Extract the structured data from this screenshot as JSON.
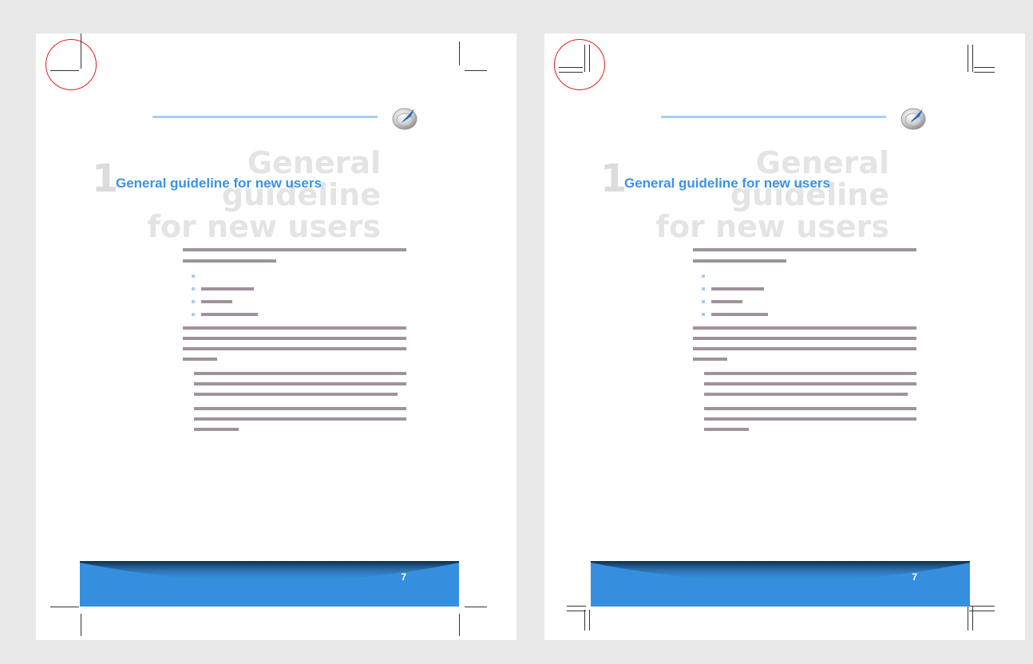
{
  "spread": {
    "left_page": {
      "chapter_number": "1",
      "chapter_title_ghost_line1": "General guideline",
      "chapter_title_ghost_line2": "for new users",
      "chapter_title": "General guideline for new users",
      "page_number": "7",
      "crop_mark_style": "single",
      "highlight_color": "#e02020"
    },
    "right_page": {
      "chapter_number": "1",
      "chapter_title_ghost_line1": "General guideline",
      "chapter_title_ghost_line2": "for new users",
      "chapter_title": "General guideline for new users",
      "page_number": "7",
      "crop_mark_style": "double",
      "highlight_color": "#e02020"
    }
  },
  "colors": {
    "accent": "#3a93e6",
    "footer": "#368fde",
    "rule": "#a8cdf4",
    "body_text_placeholder": "#9f929c"
  },
  "icons": [
    "compass-quill-logo-icon"
  ]
}
